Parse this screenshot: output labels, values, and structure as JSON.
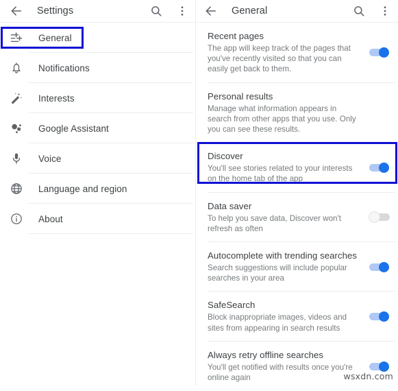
{
  "sidebar": {
    "appbar": {
      "back_icon": "arrow-back-icon",
      "title": "Settings",
      "search_icon": "search-icon",
      "overflow_icon": "more-vert-icon"
    },
    "items": [
      {
        "label": "General",
        "icon": "tune-sliders-icon",
        "selected": true
      },
      {
        "label": "Notifications",
        "icon": "bell-icon",
        "selected": false
      },
      {
        "label": "Interests",
        "icon": "magic-wand-icon",
        "selected": false
      },
      {
        "label": "Google Assistant",
        "icon": "google-assistant-icon",
        "selected": false
      },
      {
        "label": "Voice",
        "icon": "microphone-icon",
        "selected": false
      },
      {
        "label": "Language and region",
        "icon": "globe-icon",
        "selected": false
      },
      {
        "label": "About",
        "icon": "info-circle-icon",
        "selected": false
      }
    ]
  },
  "detail": {
    "appbar": {
      "back_icon": "arrow-back-icon",
      "title": "General",
      "search_icon": "search-icon",
      "overflow_icon": "more-vert-icon"
    },
    "settings": [
      {
        "title": "Recent pages",
        "desc": "The app will keep track of the pages that you've recently visited so that you can easily get back to them.",
        "control": "switch",
        "state": "on",
        "highlighted": false
      },
      {
        "title": "Personal results",
        "desc": "Manage what information appears in search from other apps that you use. Only you can see these results.",
        "control": "none",
        "state": "",
        "highlighted": false
      },
      {
        "title": "Discover",
        "desc": "You'll see stories related to your interests on the home tab of the app",
        "control": "switch",
        "state": "on",
        "highlighted": true
      },
      {
        "title": "Data saver",
        "desc": "To help you save data, Discover won't refresh as often",
        "control": "switch",
        "state": "off",
        "highlighted": false
      },
      {
        "title": "Autocomplete with trending searches",
        "desc": "Search suggestions will include popular searches in your area",
        "control": "switch",
        "state": "on",
        "highlighted": false
      },
      {
        "title": "SafeSearch",
        "desc": "Block inappropriate images, videos and sites from appearing in search results",
        "control": "switch",
        "state": "on",
        "highlighted": false
      },
      {
        "title": "Always retry offline searches",
        "desc": "You'll get notified with results once you're online again",
        "control": "switch",
        "state": "on",
        "highlighted": false
      }
    ]
  },
  "annotations": {
    "highlight_color": "#0f10d4",
    "sidebar_highlight_target": "General",
    "detail_highlight_target": "Discover"
  },
  "watermark": {
    "text": "wsxdn.com"
  },
  "theme": {
    "accent_on": "#1a73e8",
    "track_on": "#afc8f5",
    "track_off": "#d8d9da",
    "divider": "#eceded",
    "title_text": "#3c4043",
    "desc_text": "#767a7d"
  }
}
